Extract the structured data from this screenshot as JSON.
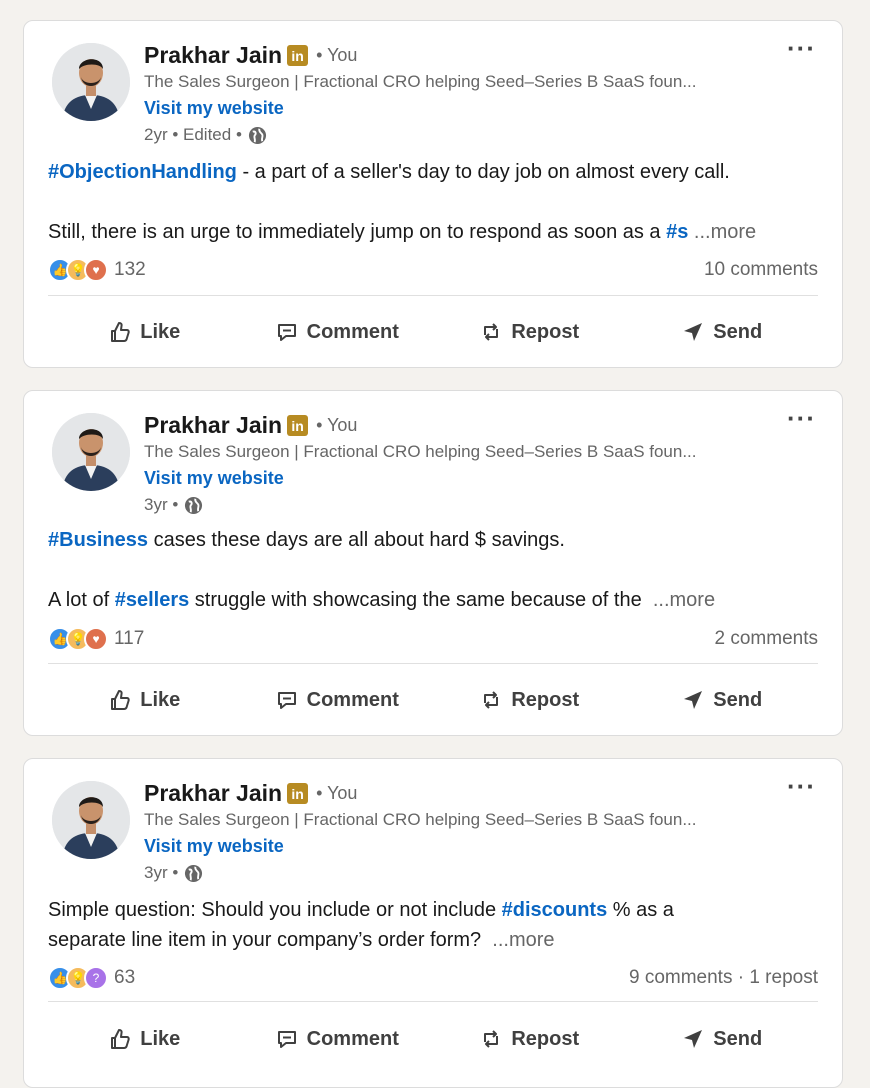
{
  "posts": [
    {
      "author": "Prakhar Jain",
      "badge": "in",
      "you": "• You",
      "headline": "The Sales Surgeon | Fractional CRO helping Seed–Series B SaaS foun...",
      "website": "Visit my website",
      "meta": "2yr • Edited •",
      "line1_tag": "#ObjectionHandling",
      "line1_text": " - a part of a seller's day to day job on almost every call.",
      "line2_pre": "Still, there is an urge to immediately jump on to respond as soon as a ",
      "line2_tag": "#s",
      "more": "...more",
      "reactions": "132",
      "comments": "10 comments",
      "icons": [
        "like-icon",
        "insightful-icon",
        "love-icon"
      ]
    },
    {
      "author": "Prakhar Jain",
      "badge": "in",
      "you": "• You",
      "headline": "The Sales Surgeon | Fractional CRO helping Seed–Series B SaaS foun...",
      "website": "Visit my website",
      "meta": "3yr •",
      "line1_tag": "#Business",
      "line1_text": " cases these days are all about hard $ savings.",
      "line2_pre": "A lot of ",
      "line2_tag": "#sellers",
      "line2_post": " struggle with showcasing the same because of the",
      "more": "...more",
      "reactions": "117",
      "comments": "2 comments",
      "icons": [
        "like-icon",
        "insightful-icon",
        "love-icon"
      ]
    },
    {
      "author": "Prakhar Jain",
      "badge": "in",
      "you": "• You",
      "headline": "The Sales Surgeon | Fractional CRO helping Seed–Series B SaaS foun...",
      "website": "Visit my website",
      "meta": "3yr •",
      "line1_pre": "Simple question: Should you include or not include ",
      "line1_tag": "#discounts",
      "line1_text": " % as a",
      "line2_pre": "separate line item in your company’s order form?",
      "more": "...more",
      "reactions": "63",
      "comments": "9 comments · 1 repost",
      "icons": [
        "like-icon",
        "insightful-icon",
        "curious-icon"
      ]
    }
  ],
  "actions": {
    "like": "Like",
    "comment": "Comment",
    "repost": "Repost",
    "send": "Send"
  },
  "menu": "···",
  "colors": {
    "link": "#0a66c2",
    "badge": "#b78b22",
    "like": "#378fe9",
    "insightful": "#f5bb5c",
    "love": "#df704d",
    "curious": "#a872e8"
  }
}
